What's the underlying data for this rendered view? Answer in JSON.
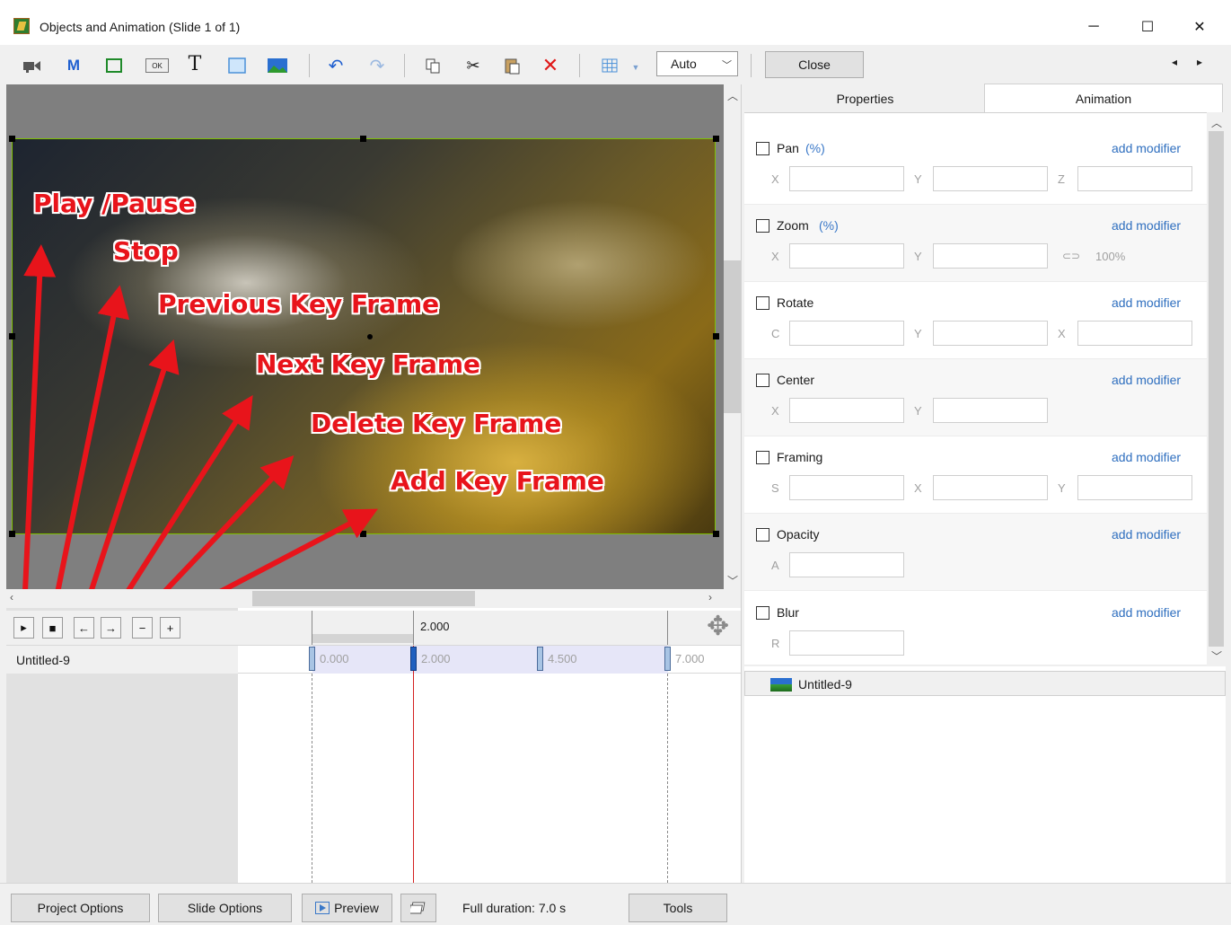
{
  "window": {
    "title": "Objects and Animation (Slide 1 of 1)",
    "minimize_glyph": "─",
    "maximize_glyph": "☐",
    "close_glyph": "✕"
  },
  "toolbar": {
    "icons": [
      "video-camera-icon",
      "mask-icon",
      "frame-icon",
      "ok-button-icon",
      "text-icon",
      "rectangle-icon",
      "image-icon",
      "undo-icon",
      "redo-icon",
      "copy-icon",
      "cut-icon",
      "paste-icon",
      "delete-icon",
      "grid-icon"
    ],
    "mask_glyph": "M",
    "ok_glyph": "OK",
    "text_glyph": "T",
    "auto_value": "Auto",
    "close_label": "Close",
    "prev_glyph": "◂",
    "next_glyph": "▸"
  },
  "annotations": {
    "play_pause": "Play /Pause",
    "stop": "Stop",
    "previous_key_frame": "Previous Key Frame",
    "next_key_frame": "Next Key Frame",
    "delete_key_frame": "Delete Key Frame",
    "add_key_frame": "Add Key Frame",
    "arrow_color": "#e8141b"
  },
  "timeline": {
    "controls": {
      "play": "▸",
      "stop": "■",
      "prev": "←",
      "next": "→",
      "delete": "−",
      "add": "+"
    },
    "ruler_label": "2.000",
    "track_name": "Untitled-9",
    "keyframes": [
      "0.000",
      "2.000",
      "4.500",
      "7.000"
    ],
    "move_glyph": "✥"
  },
  "right_panel": {
    "tabs": [
      "Properties",
      "Animation"
    ],
    "active_tab": "Animation",
    "add_modifier": "add modifier",
    "groups": [
      {
        "name": "Pan",
        "unit": "(%)",
        "fields": [
          "X",
          "Y",
          "Z"
        ]
      },
      {
        "name": "Zoom",
        "unit": "(%)",
        "fields": [
          "X",
          "Y"
        ],
        "link_value": "100%"
      },
      {
        "name": "Rotate",
        "unit": "",
        "fields": [
          "C",
          "Y",
          "X"
        ]
      },
      {
        "name": "Center",
        "unit": "",
        "fields": [
          "X",
          "Y"
        ]
      },
      {
        "name": "Framing",
        "unit": "",
        "fields": [
          "S",
          "X",
          "Y"
        ]
      },
      {
        "name": "Opacity",
        "unit": "",
        "fields": [
          "A"
        ]
      },
      {
        "name": "Blur",
        "unit": "",
        "fields": [
          "R"
        ]
      }
    ],
    "object_list": [
      "Untitled-9"
    ]
  },
  "bottom_bar": {
    "project_options": "Project Options",
    "slide_options": "Slide Options",
    "preview": "Preview",
    "duration": "Full duration: 7.0 s",
    "tools": "Tools"
  }
}
